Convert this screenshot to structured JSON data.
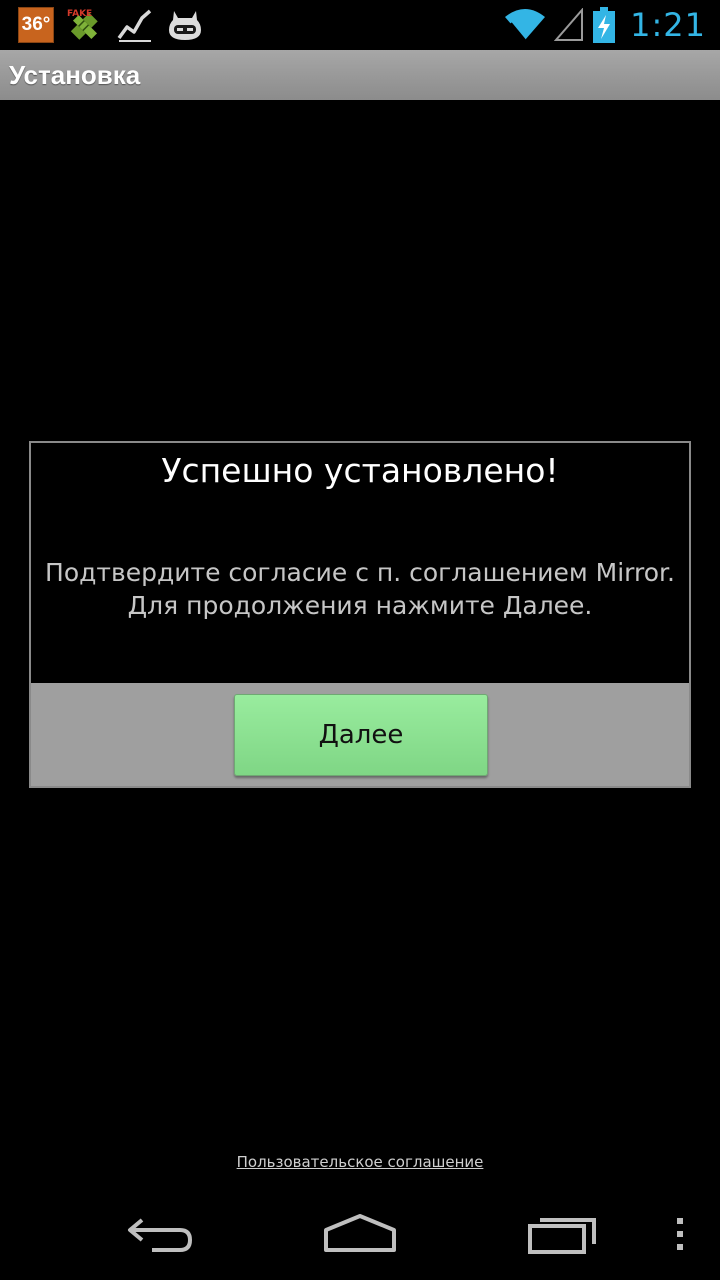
{
  "status_bar": {
    "temperature": "36°",
    "clock": "1:21",
    "icons": [
      "temperature-icon",
      "fake-gps-icon",
      "stats-icon",
      "cyanogenmod-icon",
      "wifi-icon",
      "cell-signal-icon",
      "battery-charging-icon"
    ],
    "accent_color": "#33b5e5"
  },
  "title_bar": {
    "title": "Установка"
  },
  "dialog": {
    "title": "Успешно установлено!",
    "message_line1": "Подтвердите согласие с п. соглашением Mirror.",
    "message_line2": "Для продолжения нажмите Далее.",
    "next_button_label": "Далее",
    "button_color": "#8fe394"
  },
  "footer": {
    "agreement_link": "Пользовательское соглашение"
  },
  "nav_bar": {
    "buttons": [
      "back-icon",
      "home-icon",
      "recent-apps-icon",
      "menu-icon"
    ]
  }
}
